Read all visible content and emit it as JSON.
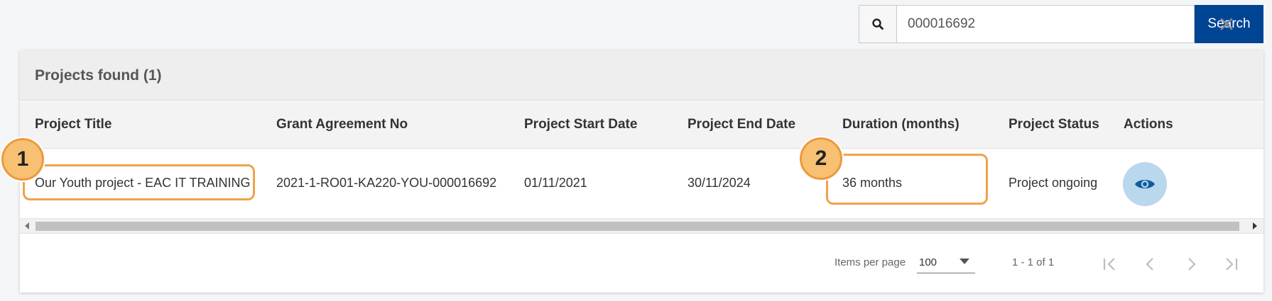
{
  "search": {
    "icon": "search-icon",
    "value": "000016692",
    "clear_icon": "close-icon",
    "button_label": "Search"
  },
  "results": {
    "title": "Projects found (1)",
    "columns": [
      "Project Title",
      "Grant Agreement No",
      "Project Start Date",
      "Project End Date",
      "Duration (months)",
      "Project Status",
      "Actions"
    ],
    "rows": [
      {
        "title": "Our Youth project - EAC IT TRAINING",
        "grant_no": "2021-1-RO01-KA220-YOU-000016692",
        "start": "01/11/2021",
        "end": "30/11/2024",
        "duration": "36 months",
        "status": "Project ongoing",
        "action_icon": "eye-icon"
      }
    ]
  },
  "paginator": {
    "items_per_page_label": "Items per page",
    "items_per_page_value": "100",
    "range": "1 - 1 of 1",
    "buttons": [
      "first-page-icon",
      "previous-page-icon",
      "next-page-icon",
      "last-page-icon"
    ]
  },
  "annotations": {
    "callouts": [
      "1",
      "2"
    ],
    "highlight_color": "#f0a24b",
    "badge_color": "#f7c072"
  },
  "colors": {
    "primary": "#004494",
    "view_button_bg": "#b9d7ed",
    "view_icon": "#0b5d9b"
  }
}
